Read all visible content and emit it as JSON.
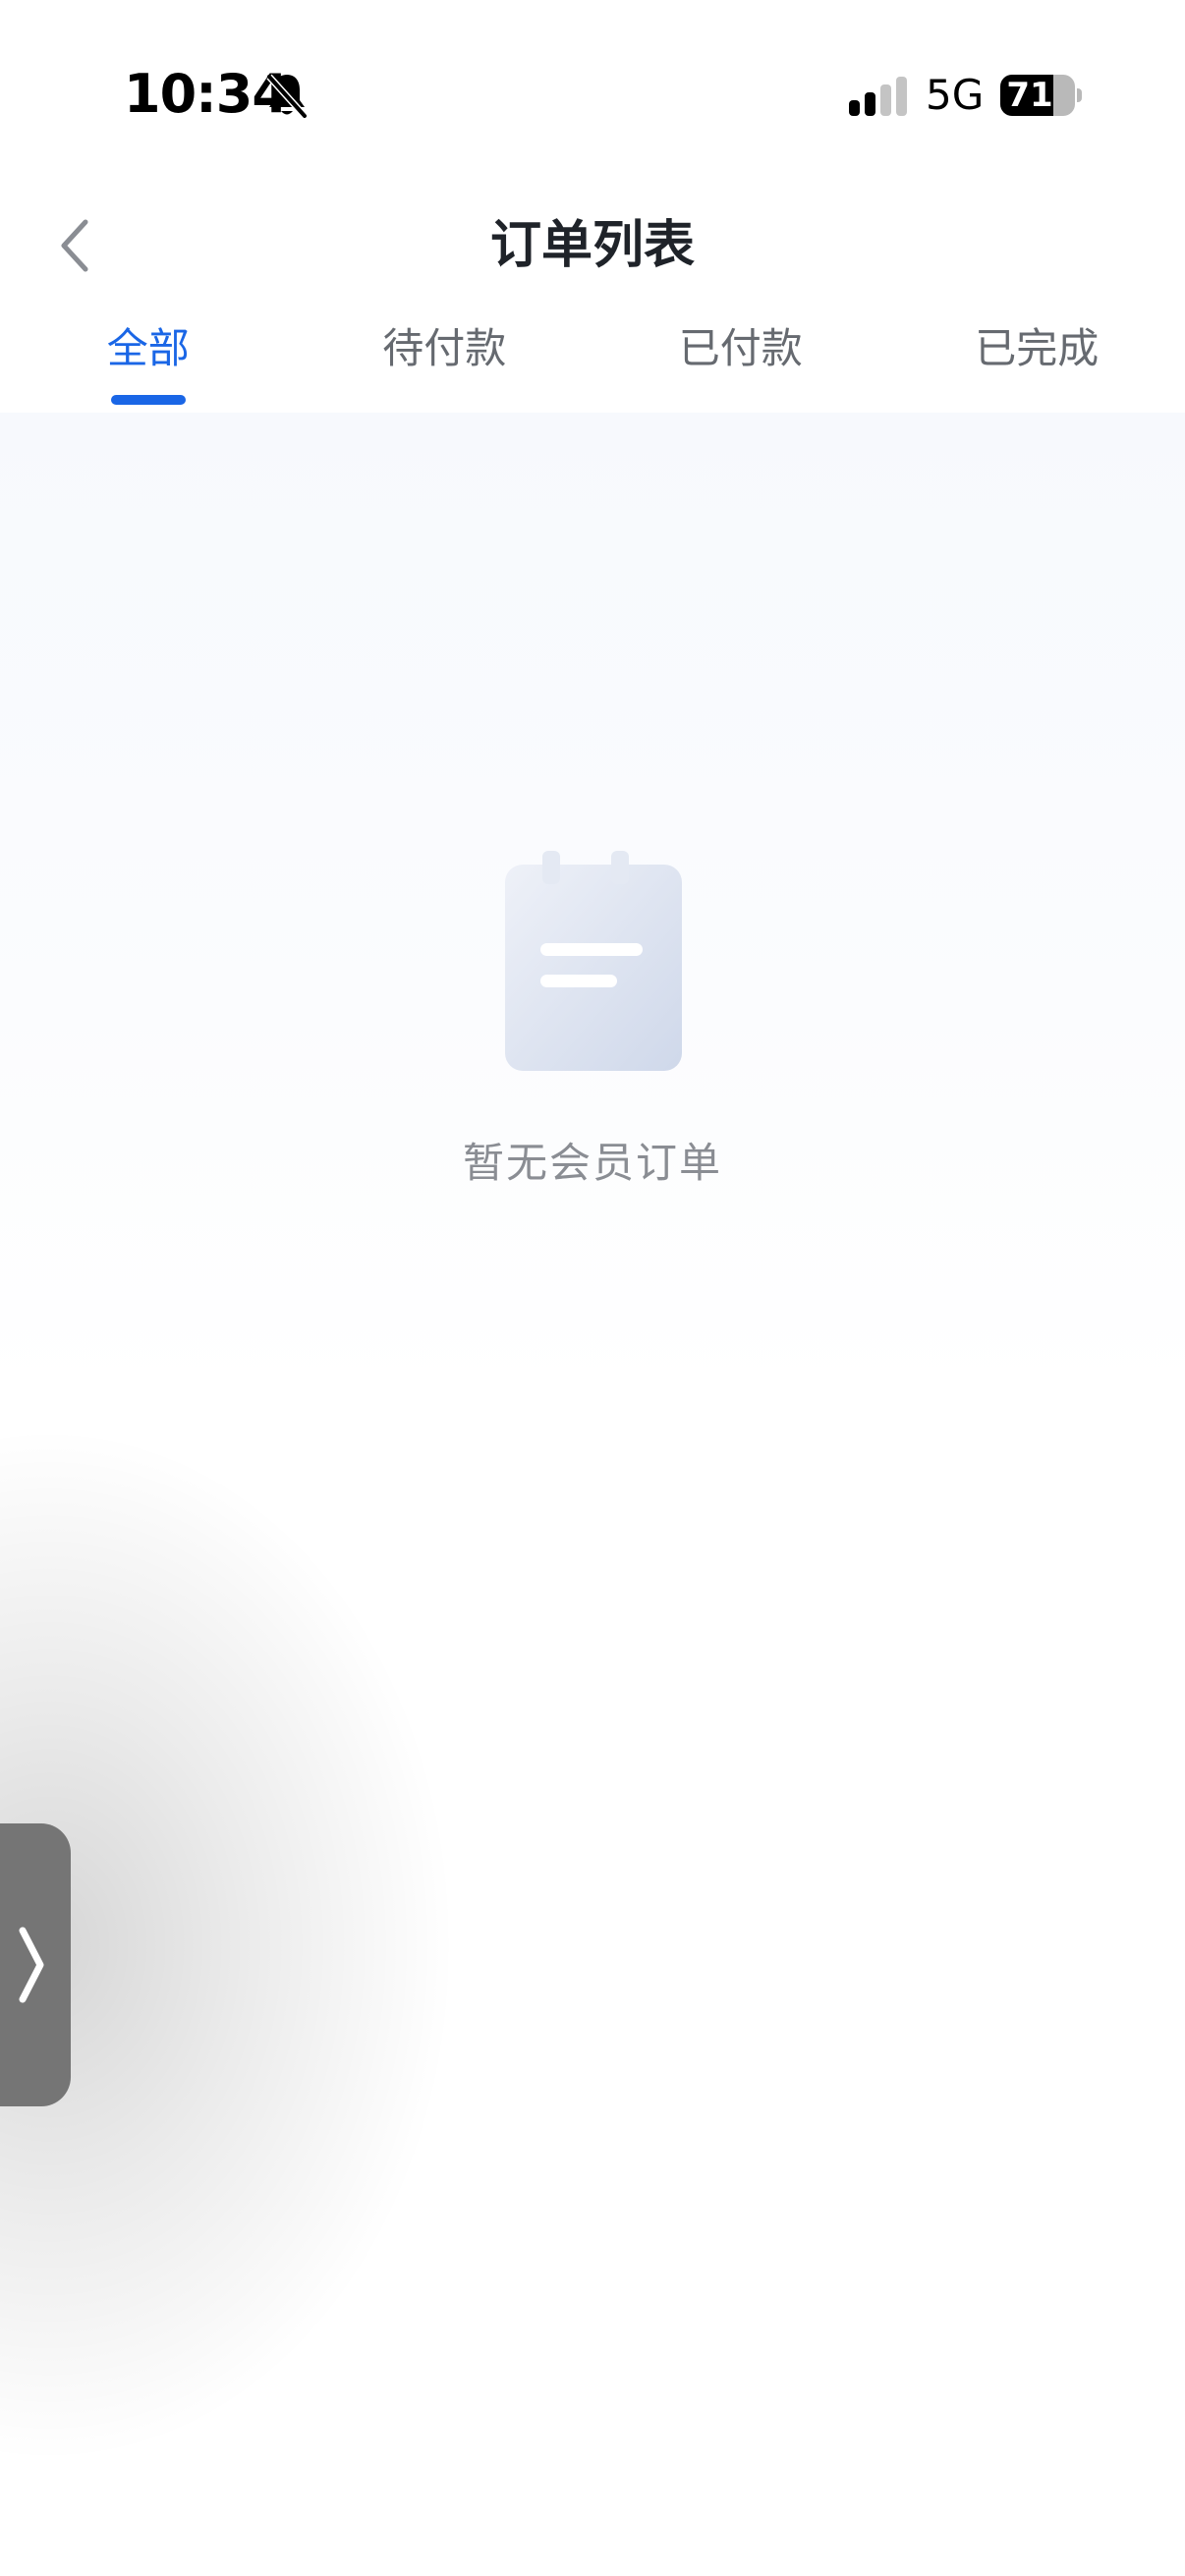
{
  "status_bar": {
    "time": "10:34",
    "network": "5G",
    "battery": 71,
    "battery_label": "71",
    "icons": [
      "bell-slash-icon",
      "cellular-signal-icon",
      "battery-icon"
    ]
  },
  "header": {
    "title": "订单列表",
    "back_icon": "chevron-left-icon"
  },
  "tabs": [
    {
      "label": "全部",
      "active": true
    },
    {
      "label": "待付款",
      "active": false
    },
    {
      "label": "已付款",
      "active": false
    },
    {
      "label": "已完成",
      "active": false
    }
  ],
  "empty_state": {
    "icon": "notepad-icon",
    "message": "暂无会员订单"
  },
  "side_handle": {
    "icon": "chevron-right-icon"
  },
  "colors": {
    "accent": "#1a66e6",
    "title_text": "#1f2329",
    "tab_text": "#666a70",
    "empty_text": "#8a8d93",
    "handle_bg": "#757575"
  }
}
